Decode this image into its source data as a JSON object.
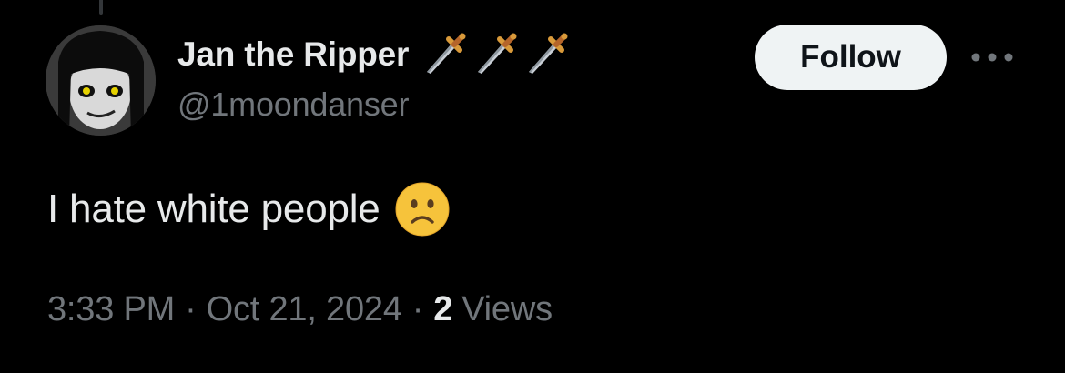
{
  "post": {
    "author": {
      "display_name": "Jan the Ripper",
      "name_emojis": [
        "dagger-icon",
        "dagger-icon",
        "dagger-icon"
      ],
      "handle": "@1moondanser",
      "avatar": "avatar-image"
    },
    "follow_label": "Follow",
    "more_icon": "more-options-icon",
    "text": "I hate white people",
    "text_emoji": "slightly-frowning-face-icon",
    "meta": {
      "time": "3:33 PM",
      "separator": "·",
      "date": "Oct 21, 2024",
      "views_count": "2",
      "views_label": "Views"
    }
  },
  "colors": {
    "background": "#000000",
    "primary_text": "#e7e9ea",
    "secondary_text": "#71767b",
    "follow_bg": "#eff3f4",
    "follow_text": "#0f1419"
  }
}
